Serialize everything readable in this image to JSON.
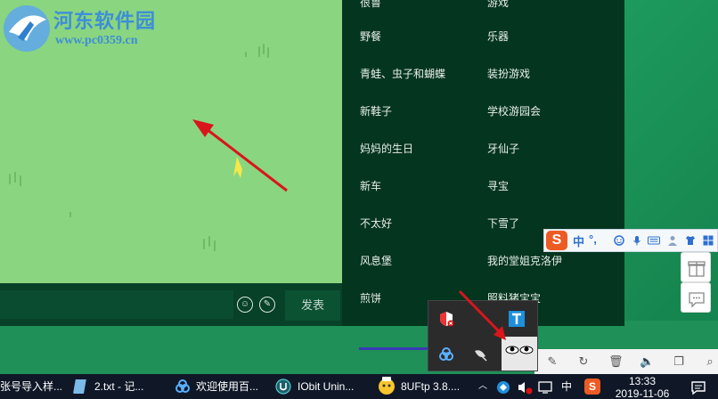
{
  "watermark": {
    "title": "河东软件园",
    "url": "www.pc0359.cn"
  },
  "story_list": {
    "left": [
      {
        "label": "很鲁"
      },
      {
        "label": "野餐"
      },
      {
        "label": "青蛙、虫子和蝴蝶"
      },
      {
        "label": "新鞋子"
      },
      {
        "label": "妈妈的生日"
      },
      {
        "label": "新车"
      },
      {
        "label": "不太好"
      },
      {
        "label": "风息堡"
      },
      {
        "label": "煎饼"
      }
    ],
    "right": [
      {
        "label": "游戏"
      },
      {
        "label": "乐器"
      },
      {
        "label": "装扮游戏"
      },
      {
        "label": "学校游园会"
      },
      {
        "label": "牙仙子"
      },
      {
        "label": "寻宝"
      },
      {
        "label": "下雪了"
      },
      {
        "label": "我的堂姐克洛伊"
      },
      {
        "label": "照料猪宝宝"
      }
    ]
  },
  "comment": {
    "send_label": "发表"
  },
  "sogou_bar": {
    "logo": "S",
    "mode": "中",
    "punct": "°,"
  },
  "taskbar": {
    "items": [
      {
        "label": "张号导入样..."
      },
      {
        "label": "2.txt - 记..."
      },
      {
        "label": "欢迎使用百..."
      },
      {
        "label": "IObit Unin..."
      },
      {
        "label": "8UFtp 3.8...."
      }
    ],
    "ime": "中",
    "ime_logo": "S",
    "time": "13:33",
    "date": "2019-11-06"
  },
  "colors": {
    "game_bg": "#8ad57f",
    "panel_bg": "#04351f",
    "arrow": "#d8161b",
    "taskbar": "#101828"
  }
}
